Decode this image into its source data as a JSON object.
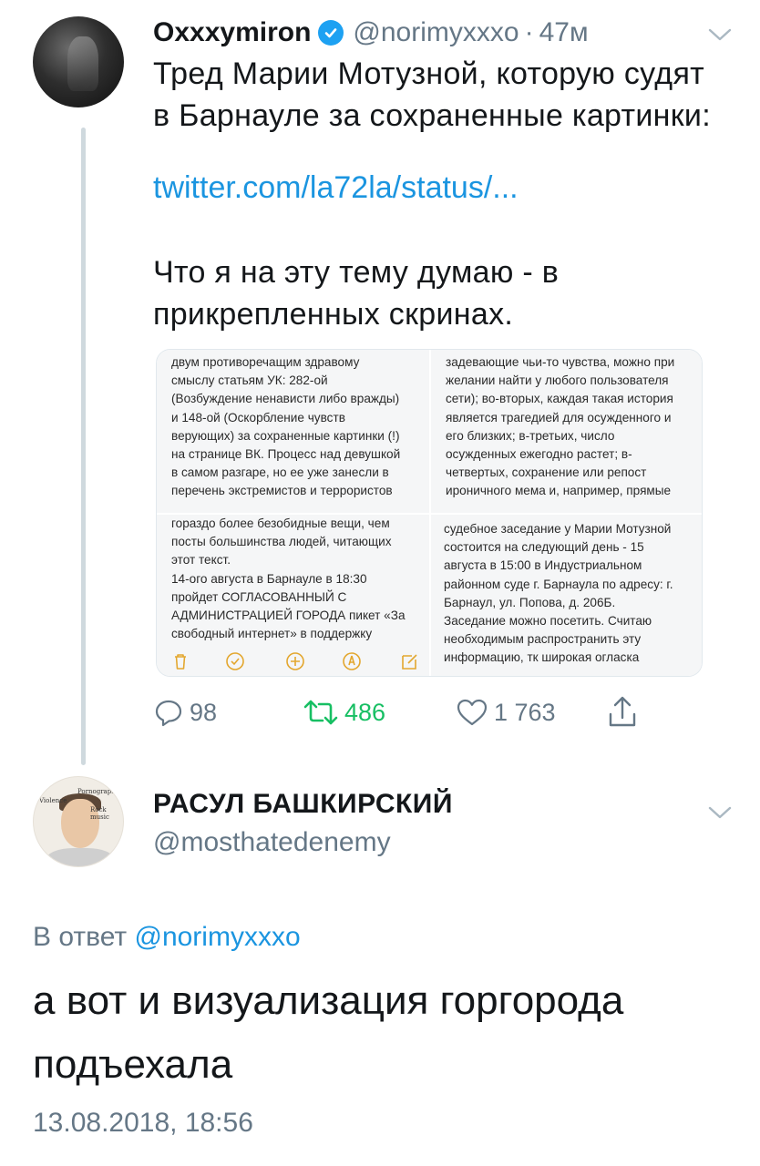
{
  "tweet": {
    "author_name": "Oxxxymiron",
    "handle": "@norimyxxxo",
    "separator": "·",
    "time": "47м",
    "text_line1": "Тред Марии Мотузной, которую судят",
    "text_line2": "в Барнауле за сохраненные картинки:",
    "link": "twitter.com/la72la/status/...",
    "text_line3": "Что я на эту тему думаю - в",
    "text_line4": "прикрепленных скринах.",
    "media": {
      "top_left": [
        "двум противоречащим здравому",
        "смыслу статьям УК: 282-ой",
        "(Возбуждение ненависти либо вражды)",
        "и 148-ой (Оскорбление чувств",
        "верующих) за сохраненные картинки (!)",
        "на странице ВК. Процесс над девушкой",
        "в самом разгаре, но ее уже занесли в",
        "перечень экстремистов и террористов"
      ],
      "top_right": [
        "задевающие чьи-то чувства, можно при",
        "желании найти у любого пользователя",
        "сети); во-вторых, каждая такая история",
        "является трагедией для осужденного и",
        "его близких; в-третьих, число",
        "осужденных ежегодно растет; в-",
        "четвертых, сохранение или репост",
        "ироничного мема и, например, прямые"
      ],
      "bottom_left": [
        "гораздо более безобидные вещи, чем",
        "посты большинства людей, читающих",
        "этот текст.",
        "14-ого августа в Барнауле в 18:30",
        "пройдет СОГЛАСОВАННЫЙ С",
        "АДМИНИСТРАЦИЕЙ ГОРОДА пикет «За",
        "свободный интернет» в поддержку"
      ],
      "bottom_right": [
        "судебное заседание у Марии Мотузной",
        "состоится на следующий день - 15",
        "августа в 15:00 в Индустриальном",
        "районном суде г. Барнаула по адресу: г.",
        "Барнаул, ул. Попова, д. 206Б.",
        "Заседание можно посетить. Считаю",
        "необходимым распространить эту",
        "информацию, тк широкая огласка"
      ]
    },
    "actions": {
      "replies": "98",
      "retweets": "486",
      "likes": "1 763"
    },
    "icons": [
      "verified-badge-icon",
      "chevron-down-icon",
      "reply-icon",
      "retweet-icon",
      "like-icon",
      "share-icon",
      "trash-icon",
      "check-icon",
      "plus-icon",
      "pen-icon",
      "compose-icon"
    ]
  },
  "reply": {
    "author_name": "РАСУЛ БАШКИРСКИЙ",
    "handle": "@mosthatedenemy",
    "replying_prefix": "В ответ",
    "replying_to": "@norimyxxxo",
    "text_line1": "а вот и визуализация горгорода",
    "text_line2": "подъехала",
    "timestamp": "13.08.2018, 18:56",
    "avatar_text": [
      "Violence",
      "Pornography",
      "Rock music"
    ]
  },
  "colors": {
    "text": "#14171a",
    "secondary": "#657786",
    "link": "#1b95e0",
    "verified": "#1da1f2",
    "retweet_green": "#17bf63",
    "thread_line": "#cfd9de"
  }
}
